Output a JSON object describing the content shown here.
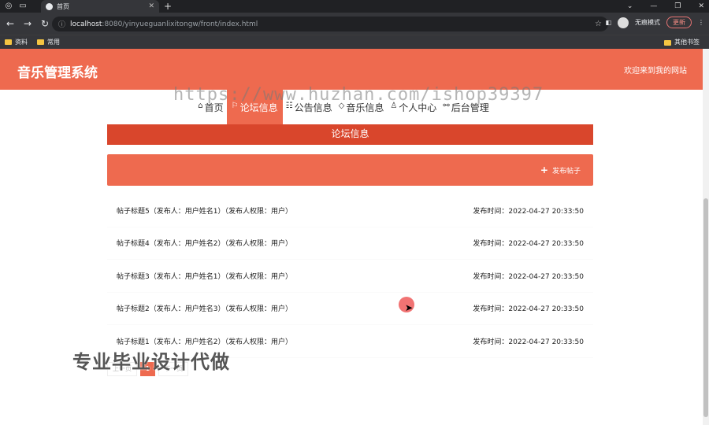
{
  "browser": {
    "tab_title": "首页",
    "url_host": "localhost",
    "url_rest": ":8080/yinyueguanlixitongw/front/index.html",
    "guest_label": "无痕模式",
    "update_label": "更新",
    "bookmarks": [
      "资料",
      "常用"
    ],
    "bookmarks_right": "其他书签"
  },
  "site": {
    "title": "音乐管理系统",
    "welcome": "欢迎来到我的网站"
  },
  "nav": {
    "items": [
      {
        "icon": "⌂",
        "label": "首页"
      },
      {
        "icon": "⚐",
        "label": "论坛信息"
      },
      {
        "icon": "☷",
        "label": "公告信息"
      },
      {
        "icon": "◇",
        "label": "音乐信息"
      },
      {
        "icon": "♙",
        "label": "个人中心"
      },
      {
        "icon": "⚯",
        "label": "后台管理"
      }
    ],
    "active_index": 1
  },
  "watermark": "https://www.huzhan.com/ishop39397",
  "section": {
    "title": "论坛信息",
    "post_button": "发布帖子"
  },
  "posts": [
    {
      "title": "帖子标题5（发布人：用户姓名1）（发布人权限：用户）",
      "time": "发布时间：2022-04-27 20:33:50"
    },
    {
      "title": "帖子标题4（发布人：用户姓名2）（发布人权限：用户）",
      "time": "发布时间：2022-04-27 20:33:50"
    },
    {
      "title": "帖子标题3（发布人：用户姓名1）（发布人权限：用户）",
      "time": "发布时间：2022-04-27 20:33:50"
    },
    {
      "title": "帖子标题2（发布人：用户姓名3）（发布人权限：用户）",
      "time": "发布时间：2022-04-27 20:33:50"
    },
    {
      "title": "帖子标题1（发布人：用户姓名2）（发布人权限：用户）",
      "time": "发布时间：2022-04-27 20:33:50"
    }
  ],
  "pager": {
    "prev": "上一页",
    "current": "1",
    "next": "下一页"
  },
  "overlay_text": "专业毕业设计代做",
  "colors": {
    "accent": "#ee6a4f",
    "banner": "#d9462c"
  }
}
